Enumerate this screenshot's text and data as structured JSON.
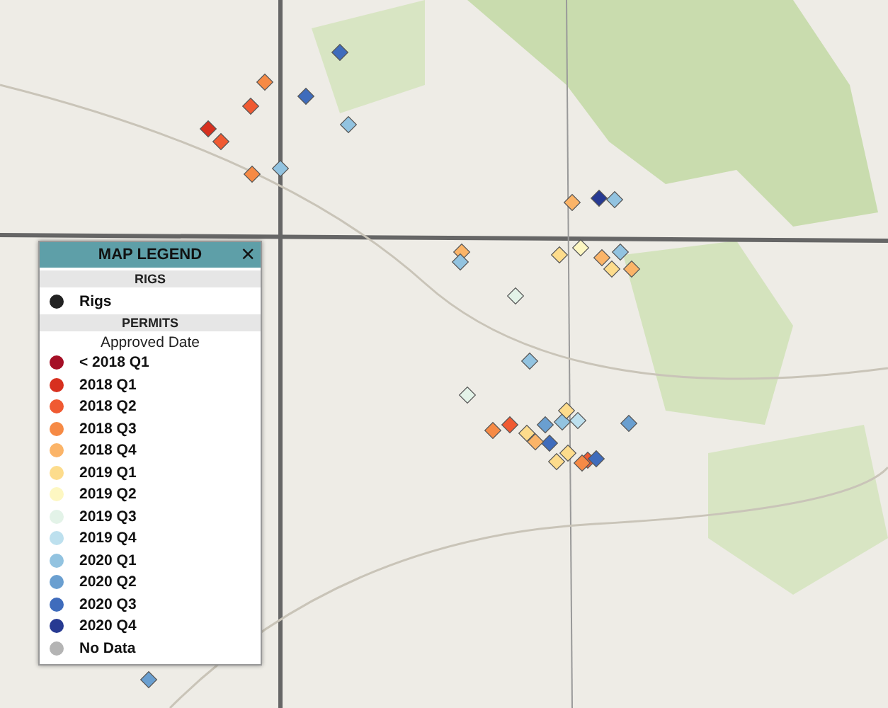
{
  "legend": {
    "title": "MAP LEGEND",
    "close": "×",
    "sections": [
      {
        "heading": "RIGS",
        "items": [
          {
            "label": "Rigs",
            "color": "#222222"
          }
        ]
      },
      {
        "heading": "PERMITS",
        "subtitle": "Approved Date",
        "items": [
          {
            "label": "< 2018 Q1",
            "color": "#a50f26"
          },
          {
            "label": "2018 Q1",
            "color": "#d7301f"
          },
          {
            "label": "2018 Q2",
            "color": "#f05a32"
          },
          {
            "label": "2018 Q3",
            "color": "#f68a45"
          },
          {
            "label": "2018 Q4",
            "color": "#fbb468"
          },
          {
            "label": "2019 Q1",
            "color": "#fddc8c"
          },
          {
            "label": "2019 Q2",
            "color": "#fdf7c2"
          },
          {
            "label": "2019 Q3",
            "color": "#e3f3e8"
          },
          {
            "label": "2019 Q4",
            "color": "#bde0ee"
          },
          {
            "label": "2020 Q1",
            "color": "#92c3e0"
          },
          {
            "label": "2020 Q2",
            "color": "#6a9fd0"
          },
          {
            "label": "2020 Q3",
            "color": "#3f6cbc"
          },
          {
            "label": "2020 Q4",
            "color": "#273a92"
          },
          {
            "label": "No Data",
            "color": "#b4b4b4"
          }
        ]
      }
    ]
  }
}
